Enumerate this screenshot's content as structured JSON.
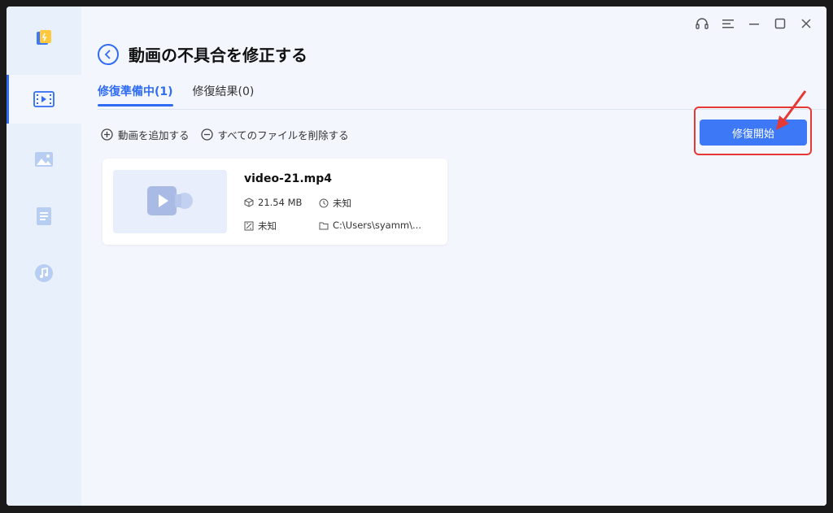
{
  "window": {
    "title": "動画の不具合を修正する"
  },
  "sidebar": {
    "items": [
      {
        "name": "video-repair",
        "icon": "video-icon",
        "active": true
      },
      {
        "name": "photo-repair",
        "icon": "image-icon",
        "active": false
      },
      {
        "name": "document-repair",
        "icon": "document-icon",
        "active": false
      },
      {
        "name": "audio-repair",
        "icon": "music-icon",
        "active": false
      }
    ]
  },
  "controls": [
    "headset-icon",
    "menu-icon",
    "minimize-icon",
    "maximize-icon",
    "close-icon"
  ],
  "tabs": [
    {
      "label": "修復準備中(1)",
      "active": true
    },
    {
      "label": "修復結果(0)",
      "active": false
    }
  ],
  "toolbar": {
    "add_label": "動画を追加する",
    "remove_all_label": "すべてのファイルを削除する",
    "start_label": "修復開始"
  },
  "file": {
    "name": "video-21.mp4",
    "size": "21.54 MB",
    "duration": "未知",
    "resolution": "未知",
    "path": "C:\\Users\\syamm\\..."
  },
  "colors": {
    "accent": "#2f6cf3",
    "button": "#3d79f6",
    "highlight": "#e53935",
    "background": "#f3f7fd",
    "sidebar": "#e8f0fb"
  }
}
